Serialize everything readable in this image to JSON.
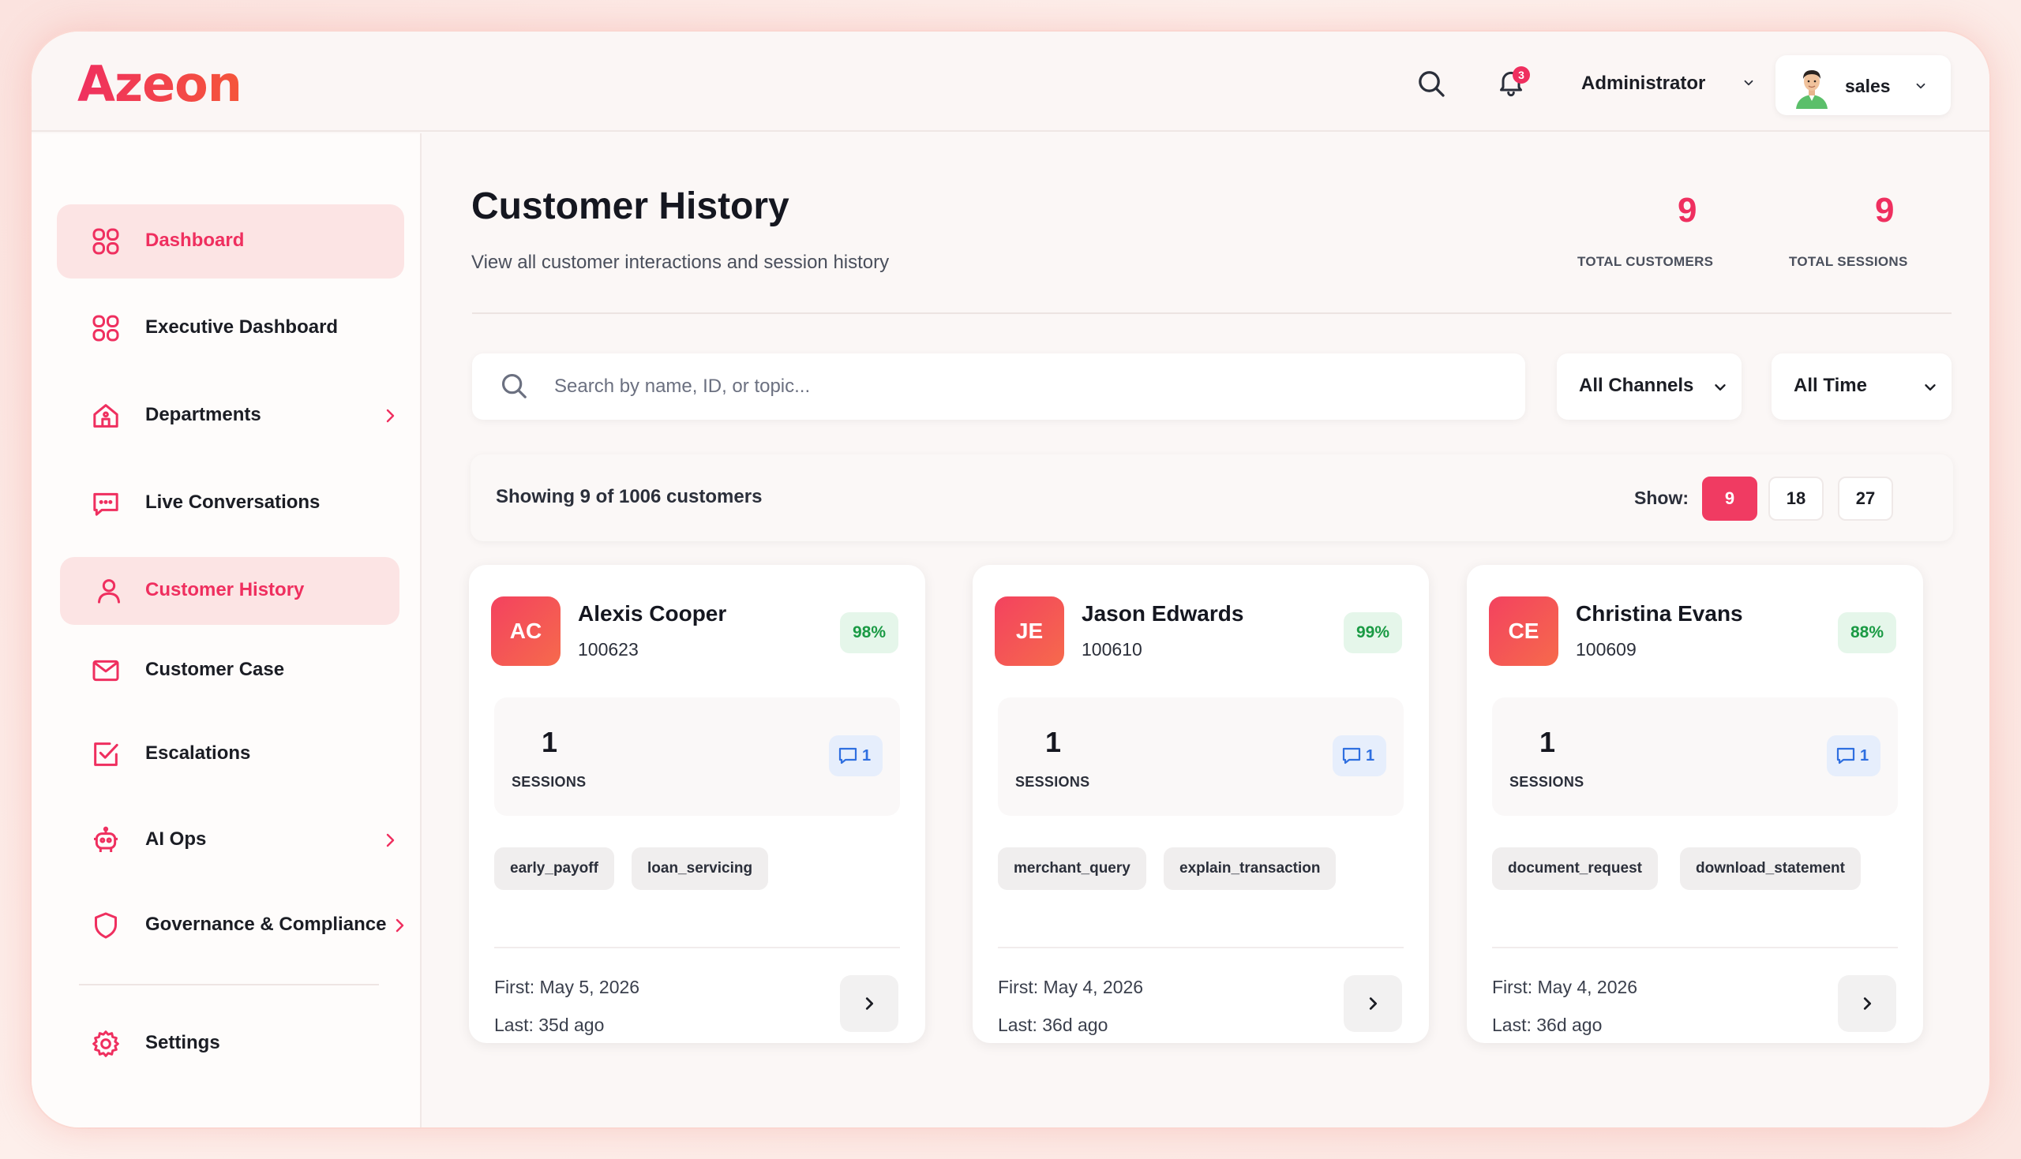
{
  "brand": {
    "logo_text": "Azeon",
    "accent_color": "#ef2f5f"
  },
  "header": {
    "notification_count": "3",
    "role_label": "Administrator",
    "user_name": "sales"
  },
  "sidebar": {
    "items": [
      {
        "label": "Dashboard",
        "icon": "grid-icon",
        "active": true
      },
      {
        "label": "Executive Dashboard",
        "icon": "grid-icon"
      },
      {
        "label": "Departments",
        "icon": "building-icon",
        "has_children": true
      },
      {
        "label": "Live Conversations",
        "icon": "chat-icon"
      },
      {
        "label": "Customer History",
        "icon": "user-icon",
        "active": true
      },
      {
        "label": "Customer Case",
        "icon": "mail-icon"
      },
      {
        "label": "Escalations",
        "icon": "check-square-icon"
      },
      {
        "label": "AI Ops",
        "icon": "robot-icon",
        "has_children": true
      },
      {
        "label": "Governance & Compliance",
        "icon": "shield-icon",
        "has_children": true
      },
      {
        "label": "Settings",
        "icon": "gear-icon"
      }
    ]
  },
  "page": {
    "title": "Customer History",
    "subtitle": "View all customer interactions and session history",
    "stats": [
      {
        "value": "9",
        "label": "TOTAL CUSTOMERS"
      },
      {
        "value": "9",
        "label": "TOTAL SESSIONS"
      }
    ]
  },
  "filters": {
    "search_placeholder": "Search by name, ID, or topic...",
    "search_value": "",
    "channel_selected": "All Channels",
    "time_selected": "All Time"
  },
  "pagination": {
    "showing_text": "Showing 9 of 1006 customers",
    "show_label": "Show:",
    "options": [
      "9",
      "18",
      "27"
    ],
    "selected": "9"
  },
  "customers": [
    {
      "initials": "AC",
      "name": "Alexis Cooper",
      "id": "100623",
      "score": "98%",
      "sessions": "1",
      "sessions_label": "SESSIONS",
      "messages": "1",
      "tags": [
        "early_payoff",
        "loan_servicing"
      ],
      "first": "First: May 5, 2026",
      "last": "Last: 35d ago"
    },
    {
      "initials": "JE",
      "name": "Jason Edwards",
      "id": "100610",
      "score": "99%",
      "sessions": "1",
      "sessions_label": "SESSIONS",
      "messages": "1",
      "tags": [
        "merchant_query",
        "explain_transaction"
      ],
      "first": "First: May 4, 2026",
      "last": "Last: 36d ago"
    },
    {
      "initials": "CE",
      "name": "Christina Evans",
      "id": "100609",
      "score": "88%",
      "sessions": "1",
      "sessions_label": "SESSIONS",
      "messages": "1",
      "tags": [
        "document_request",
        "download_statement"
      ],
      "first": "First: May 4, 2026",
      "last": "Last: 36d ago"
    }
  ]
}
